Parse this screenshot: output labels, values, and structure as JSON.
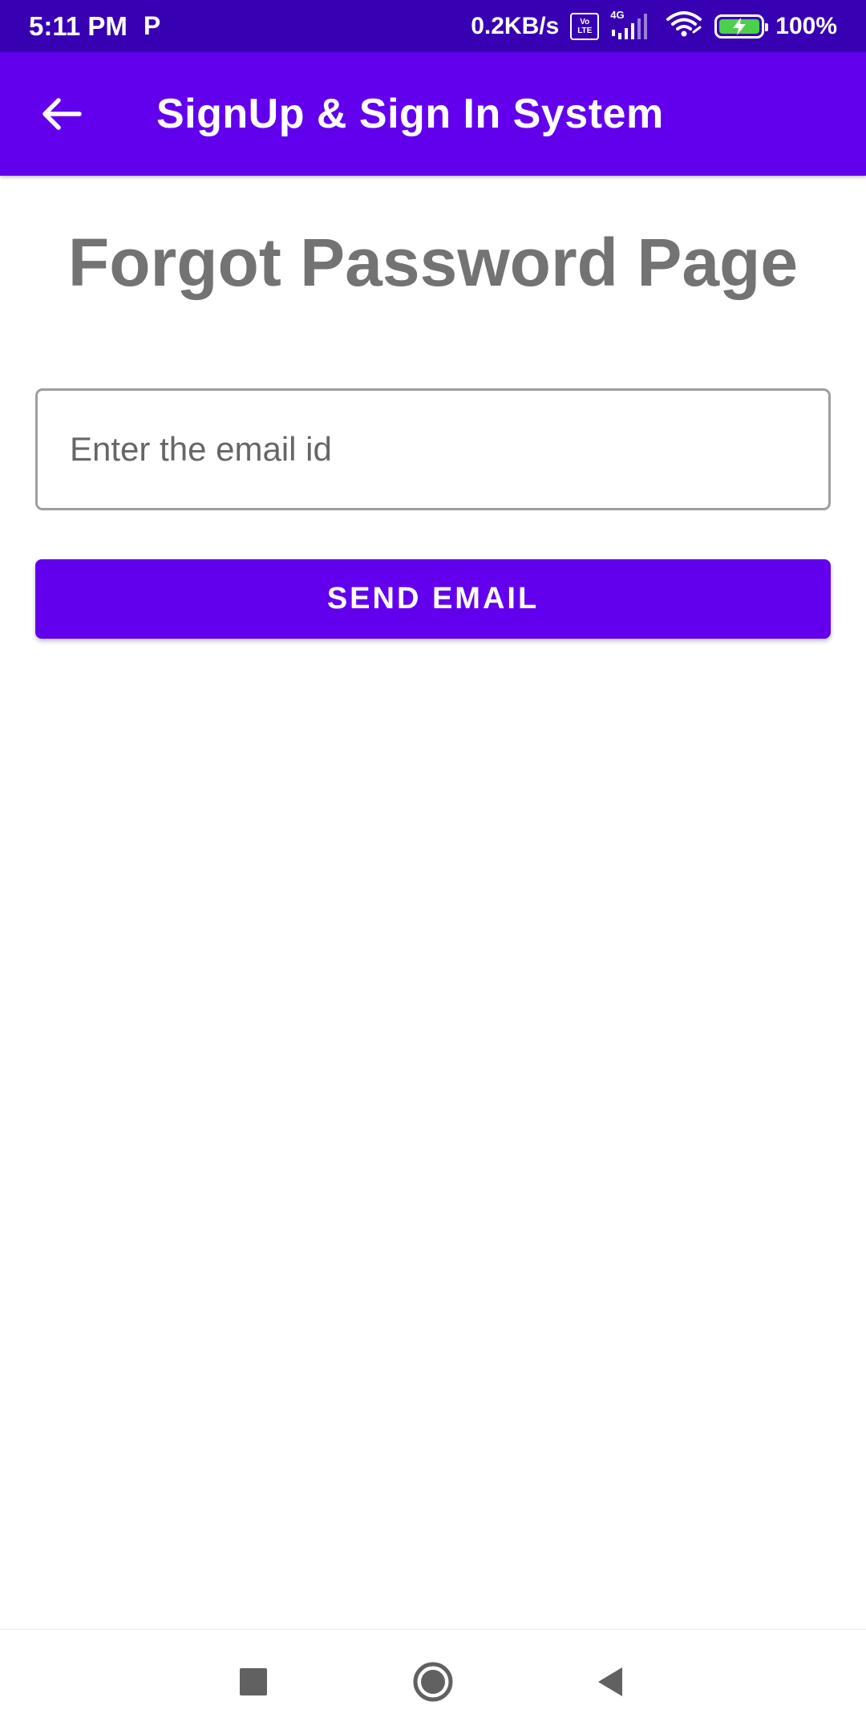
{
  "status_bar": {
    "time": "5:11 PM",
    "notification_letter": "P",
    "net_speed": "0.2KB/s",
    "volte_top": "Vo",
    "volte_bottom": "LTE",
    "network_type": "4G",
    "battery_percent": "100%",
    "battery_level": 1.0,
    "icons": [
      "parking-app-icon",
      "volte-icon",
      "signal-icon",
      "wifi-icon",
      "battery-charging-icon"
    ]
  },
  "app_bar": {
    "title": "SignUp & Sign In System",
    "back_icon": "arrow-back-icon"
  },
  "main": {
    "heading": "Forgot Password Page",
    "email_input": {
      "placeholder": "Enter the email id",
      "value": ""
    },
    "send_button_label": "SEND EMAIL"
  },
  "nav_bar": {
    "icons": [
      "recents-square-icon",
      "home-circle-icon",
      "back-triangle-icon"
    ]
  },
  "colors": {
    "status_bar": "#3700b3",
    "primary": "#6200ee",
    "heading_text": "#737373",
    "field_border": "#9e9e9e",
    "battery_fill": "#4cd04c",
    "nav_icon": "#616161"
  }
}
